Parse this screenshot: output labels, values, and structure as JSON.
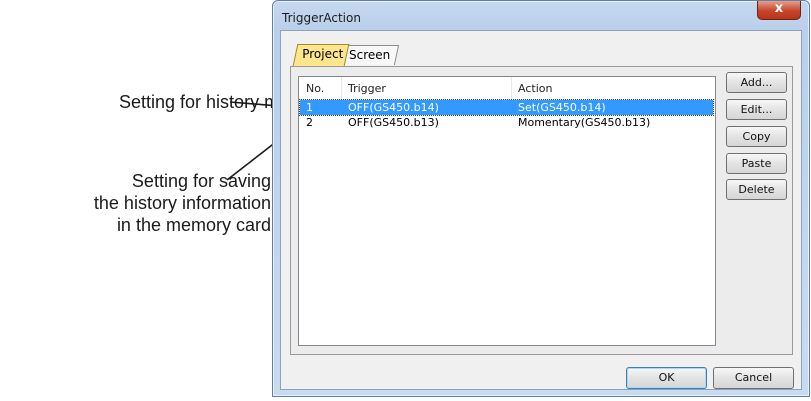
{
  "annotations": {
    "history_mode": "Setting for history mode",
    "memory_card_lines": [
      "Setting for saving",
      "the history information",
      "in the memory card"
    ]
  },
  "dialog": {
    "title": "TriggerAction",
    "close_glyph": "x",
    "tabs": [
      {
        "label": "Project",
        "selected": true
      },
      {
        "label": "Screen",
        "selected": false
      }
    ],
    "list": {
      "columns": [
        "No.",
        "Trigger",
        "Action"
      ],
      "rows": [
        {
          "no": "1",
          "trigger": "OFF(GS450.b14)",
          "action": "Set(GS450.b14)",
          "selected": true
        },
        {
          "no": "2",
          "trigger": "OFF(GS450.b13)",
          "action": "Momentary(GS450.b13)",
          "selected": false
        }
      ]
    },
    "side_buttons": {
      "add": "Add...",
      "edit": "Edit...",
      "copy": "Copy",
      "paste": "Paste",
      "delete": "Delete"
    },
    "ok": "OK",
    "cancel": "Cancel"
  },
  "colors": {
    "selection": "#3399ff",
    "active_tab": "#ffe58c",
    "close_button": "#c7442a"
  }
}
